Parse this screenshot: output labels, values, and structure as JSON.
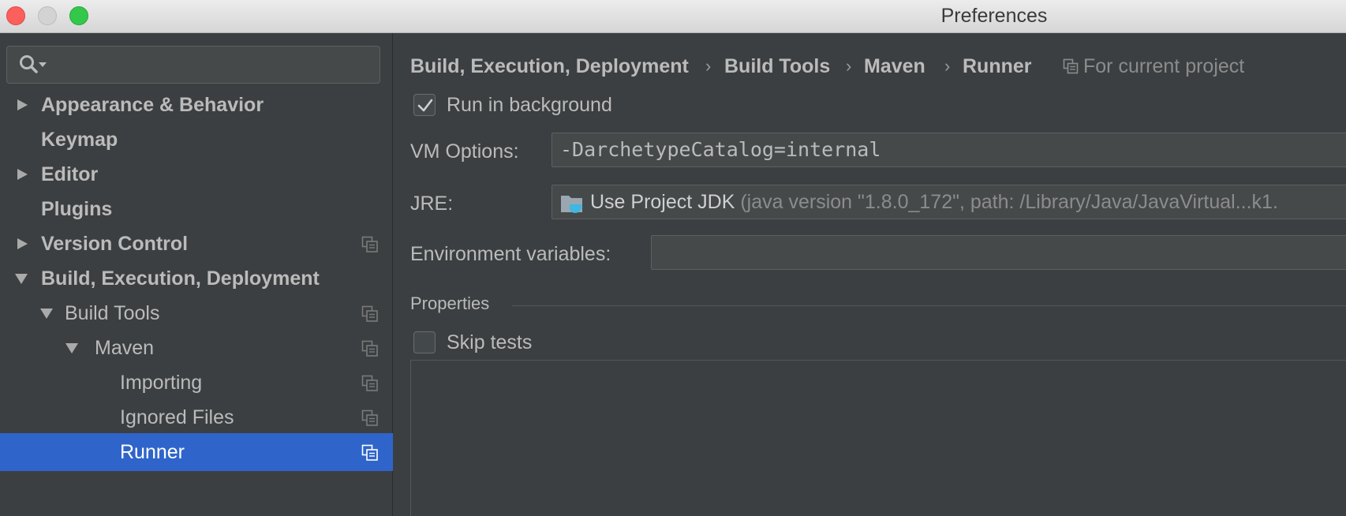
{
  "window": {
    "title": "Preferences"
  },
  "search": {
    "placeholder": ""
  },
  "sidebar": {
    "items": [
      {
        "label": "Appearance & Behavior",
        "expandable": true,
        "expanded": false,
        "bold": true,
        "project_icon": false
      },
      {
        "label": "Keymap",
        "expandable": false,
        "bold": true,
        "project_icon": false
      },
      {
        "label": "Editor",
        "expandable": true,
        "expanded": false,
        "bold": true,
        "project_icon": false
      },
      {
        "label": "Plugins",
        "expandable": false,
        "bold": true,
        "project_icon": false
      },
      {
        "label": "Version Control",
        "expandable": true,
        "expanded": false,
        "bold": true,
        "project_icon": true
      },
      {
        "label": "Build, Execution, Deployment",
        "expandable": true,
        "expanded": true,
        "bold": true,
        "project_icon": false
      },
      {
        "label": "Build Tools",
        "expandable": true,
        "expanded": true,
        "bold": false,
        "project_icon": true
      },
      {
        "label": "Maven",
        "expandable": true,
        "expanded": true,
        "bold": false,
        "project_icon": true
      },
      {
        "label": "Importing",
        "expandable": false,
        "bold": false,
        "project_icon": true
      },
      {
        "label": "Ignored Files",
        "expandable": false,
        "bold": false,
        "project_icon": true
      },
      {
        "label": "Runner",
        "expandable": false,
        "bold": false,
        "project_icon": true,
        "selected": true
      }
    ]
  },
  "breadcrumb": {
    "items": [
      "Build, Execution, Deployment",
      "Build Tools",
      "Maven",
      "Runner"
    ],
    "separator": "›",
    "scope_label": "For current project"
  },
  "form": {
    "run_in_background": {
      "label": "Run in background",
      "checked": true
    },
    "vm_options": {
      "label": "VM Options:",
      "value": "-DarchetypeCatalog=internal"
    },
    "jre": {
      "label": "JRE:",
      "value": "Use Project JDK",
      "detail": "(java version \"1.8.0_172\", path: /Library/Java/JavaVirtual...k1."
    },
    "env_vars": {
      "label": "Environment variables:",
      "value": ""
    },
    "properties": {
      "label": "Properties"
    },
    "skip_tests": {
      "label": "Skip tests",
      "checked": false
    }
  },
  "colors": {
    "background": "#3c3f41",
    "selection": "#2f65ca",
    "text": "#bbbbbb",
    "muted_text": "#8c8c8c"
  }
}
